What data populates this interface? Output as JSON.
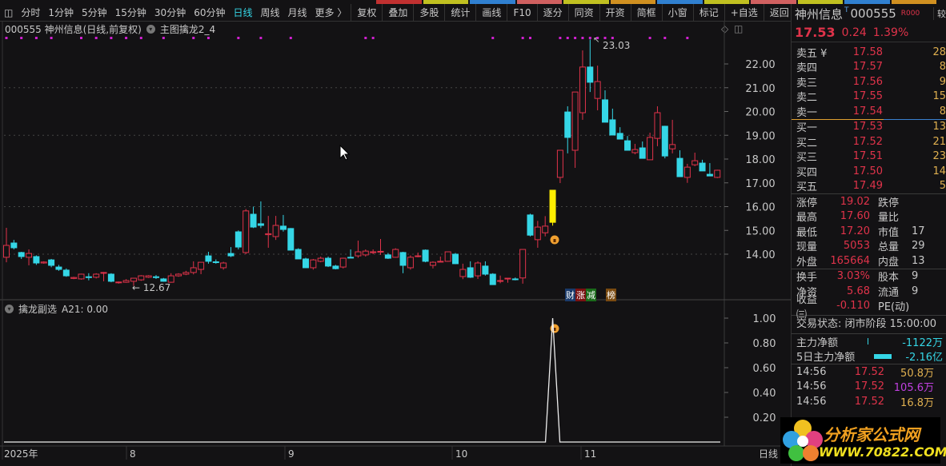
{
  "toolbar": {
    "periods": [
      "分时",
      "1分钟",
      "5分钟",
      "15分钟",
      "30分钟",
      "60分钟",
      "日线",
      "周线",
      "月线",
      "更多 〉"
    ],
    "active": "日线",
    "buttons": [
      "复权",
      "叠加",
      "多股",
      "统计",
      "画线",
      "F10",
      "逐分",
      "同资",
      "开资",
      "简框",
      "小窗",
      "标记",
      "+自选",
      "返回"
    ]
  },
  "chart_header": {
    "title": "000555 神州信息(日线,前复权)",
    "indicator": "主图擒龙2_4"
  },
  "sub_header": {
    "name": "擒龙副选",
    "value": "A21: 0.00"
  },
  "annotations": {
    "high": "23.03",
    "low": "12.67"
  },
  "event_tags": [
    {
      "text": "财",
      "bg": "#1a3a6a"
    },
    {
      "text": "涨",
      "bg": "#7a1010"
    },
    {
      "text": "减",
      "bg": "#1a6a1a"
    },
    {
      "text": "榜",
      "bg": "#7a4a10"
    }
  ],
  "time_axis": {
    "labels": [
      "2025年",
      "8",
      "9",
      "10",
      "11"
    ],
    "period": "日线"
  },
  "chart_data": {
    "type": "candlestick",
    "price_ticks": [
      "22.00",
      "21.00",
      "20.00",
      "19.00",
      "18.00",
      "17.00",
      "16.00",
      "15.00",
      "14.00"
    ],
    "price_range": [
      12.3,
      23.3
    ],
    "ohlc": [
      [
        13.87,
        15.11,
        13.66,
        14.37
      ],
      [
        14.47,
        14.6,
        14.2,
        14.27
      ],
      [
        14.07,
        14.1,
        13.8,
        13.9
      ],
      [
        13.87,
        14.2,
        13.53,
        14.03
      ],
      [
        13.9,
        13.95,
        13.55,
        13.63
      ],
      [
        13.63,
        13.7,
        13.6,
        13.67
      ],
      [
        13.76,
        13.8,
        13.45,
        13.53
      ],
      [
        13.46,
        13.55,
        13.3,
        13.36
      ],
      [
        13.33,
        13.4,
        13.05,
        13.09
      ],
      [
        12.98,
        13.05,
        12.95,
        13.02
      ],
      [
        12.96,
        13.18,
        12.93,
        13.16
      ],
      [
        13.05,
        13.2,
        12.9,
        13.02
      ],
      [
        13.03,
        13.2,
        12.98,
        13.16
      ],
      [
        13.2,
        13.25,
        12.86,
        13.23
      ],
      [
        13.16,
        13.2,
        12.82,
        12.86
      ],
      [
        12.8,
        12.85,
        12.76,
        12.83
      ],
      [
        12.82,
        12.95,
        12.8,
        12.89
      ],
      [
        12.86,
        13.0,
        12.67,
        12.99
      ],
      [
        12.92,
        13.12,
        12.88,
        13.09
      ],
      [
        13.03,
        13.12,
        13.0,
        13.09
      ],
      [
        13.05,
        13.12,
        12.96,
        13.02
      ],
      [
        12.96,
        13.0,
        12.84,
        12.86
      ],
      [
        12.82,
        13.2,
        12.8,
        13.09
      ],
      [
        13.09,
        13.2,
        13.05,
        13.16
      ],
      [
        13.16,
        13.3,
        13.12,
        13.23
      ],
      [
        13.23,
        13.7,
        13.15,
        13.43
      ],
      [
        13.36,
        13.66,
        13.16,
        13.66
      ],
      [
        13.93,
        14.1,
        13.6,
        13.7
      ],
      [
        13.68,
        13.78,
        13.6,
        13.66
      ],
      [
        13.43,
        13.68,
        13.35,
        13.63
      ],
      [
        14.03,
        14.3,
        13.88,
        13.93
      ],
      [
        14.94,
        15.0,
        14.2,
        14.3
      ],
      [
        14.07,
        15.9,
        14.0,
        15.82
      ],
      [
        15.68,
        16.0,
        15.1,
        15.14
      ],
      [
        15.28,
        16.22,
        15.1,
        15.21
      ],
      [
        14.82,
        15.61,
        14.27,
        14.86
      ],
      [
        14.74,
        15.61,
        14.6,
        15.21
      ],
      [
        15.18,
        15.65,
        14.95,
        15.04
      ],
      [
        15.08,
        15.1,
        14.17,
        14.17
      ],
      [
        14.2,
        14.25,
        13.8,
        13.8
      ],
      [
        13.8,
        13.85,
        13.43,
        13.43
      ],
      [
        13.43,
        13.8,
        13.35,
        13.76
      ],
      [
        13.7,
        13.9,
        13.66,
        13.83
      ],
      [
        13.83,
        13.9,
        13.46,
        13.5
      ],
      [
        13.5,
        13.55,
        13.36,
        13.39
      ],
      [
        13.46,
        13.85,
        13.4,
        13.83
      ],
      [
        13.87,
        14.2,
        13.85,
        13.85
      ],
      [
        13.93,
        14.57,
        13.85,
        14.1
      ],
      [
        13.97,
        14.2,
        13.9,
        14.13
      ],
      [
        14.1,
        14.2,
        14.0,
        14.1
      ],
      [
        14.1,
        14.64,
        13.97,
        14.12
      ],
      [
        13.97,
        14.05,
        13.8,
        13.83
      ],
      [
        13.87,
        14.25,
        13.85,
        14.2
      ],
      [
        14.07,
        14.1,
        13.2,
        13.53
      ],
      [
        13.43,
        13.95,
        13.35,
        13.87
      ],
      [
        13.9,
        14.07,
        13.87,
        13.93
      ],
      [
        14.17,
        14.2,
        13.66,
        13.7
      ],
      [
        13.53,
        13.7,
        13.4,
        13.66
      ],
      [
        13.67,
        13.9,
        13.66,
        13.7
      ],
      [
        13.7,
        14.1,
        13.68,
        14.1
      ],
      [
        14.0,
        14.05,
        13.58,
        13.6
      ],
      [
        13.06,
        13.6,
        12.95,
        13.36
      ],
      [
        13.43,
        13.7,
        13.0,
        13.03
      ],
      [
        13.09,
        13.7,
        12.96,
        13.63
      ],
      [
        13.5,
        13.7,
        13.1,
        13.16
      ],
      [
        13.16,
        13.2,
        12.72,
        12.72
      ],
      [
        12.86,
        13.1,
        12.78,
        12.89
      ],
      [
        12.96,
        13.0,
        12.8,
        12.99
      ],
      [
        12.96,
        13.02,
        12.9,
        12.94
      ],
      [
        13.0,
        14.2,
        12.76,
        14.2
      ],
      [
        15.65,
        15.7,
        14.75,
        14.8
      ],
      [
        14.61,
        15.4,
        14.27,
        15.14
      ],
      [
        14.9,
        15.6,
        14.75,
        15.18
      ],
      [
        15.34,
        16.69,
        15.2,
        16.69
      ],
      [
        17.23,
        18.37,
        16.99,
        18.37
      ],
      [
        19.98,
        20.22,
        18.24,
        18.91
      ],
      [
        18.37,
        20.82,
        17.63,
        20.82
      ],
      [
        19.95,
        22.57,
        19.65,
        21.87
      ],
      [
        21.87,
        23.03,
        20.82,
        21.23
      ],
      [
        20.55,
        21.93,
        20.05,
        21.26
      ],
      [
        20.49,
        20.89,
        19.55,
        19.55
      ],
      [
        19.65,
        20.12,
        19.01,
        19.01
      ],
      [
        19.08,
        19.34,
        18.84,
        18.84
      ],
      [
        18.77,
        18.97,
        18.37,
        18.37
      ],
      [
        18.27,
        18.64,
        18.2,
        18.4
      ],
      [
        18.47,
        18.74,
        18.03,
        18.03
      ],
      [
        17.97,
        19.11,
        17.97,
        18.91
      ],
      [
        18.87,
        20.22,
        18.54,
        19.95
      ],
      [
        19.38,
        19.4,
        18.03,
        18.13
      ],
      [
        18.43,
        19.65,
        18.24,
        18.61
      ],
      [
        18.03,
        18.37,
        17.26,
        17.26
      ],
      [
        17.23,
        17.8,
        17.0,
        17.66
      ],
      [
        17.76,
        18.27,
        17.7,
        17.93
      ],
      [
        17.83,
        17.97,
        17.5,
        17.5
      ],
      [
        17.36,
        17.83,
        17.3,
        17.29
      ],
      [
        17.23,
        17.55,
        17.2,
        17.53
      ]
    ],
    "highlight_index": 73,
    "signal_dots": [
      0,
      2,
      4,
      6,
      10,
      12,
      14,
      16,
      18,
      21,
      25,
      27,
      31,
      34,
      38,
      48,
      49,
      65,
      69,
      70,
      74,
      75,
      76,
      77,
      78,
      79,
      80,
      81,
      86,
      88,
      91
    ],
    "sub": {
      "ticks": [
        "1.00",
        "0.80",
        "0.60",
        "0.40",
        "0.20"
      ],
      "range": [
        0,
        1.05
      ],
      "spike_index": 73,
      "spike_value": 1.0,
      "baseline": 0
    }
  },
  "colors": {
    "up": "#e0334a",
    "down": "#35d6e6",
    "limit": "#ffee00",
    "dot": "#d020d0"
  },
  "quote": {
    "name": "神州信息",
    "code": "000555",
    "tag": "R000",
    "price": "17.53",
    "change": "0.24",
    "pct": "1.39%",
    "side_label": "较"
  },
  "book": {
    "asks": [
      {
        "l": "卖五 ¥",
        "p": "17.58",
        "v": "28"
      },
      {
        "l": "卖四",
        "p": "17.57",
        "v": "8"
      },
      {
        "l": "卖三",
        "p": "17.56",
        "v": "9"
      },
      {
        "l": "卖二",
        "p": "17.55",
        "v": "15"
      },
      {
        "l": "卖一",
        "p": "17.54",
        "v": "8"
      }
    ],
    "bids": [
      {
        "l": "买一",
        "p": "17.53",
        "v": "13"
      },
      {
        "l": "买二",
        "p": "17.52",
        "v": "21"
      },
      {
        "l": "买三",
        "p": "17.51",
        "v": "23"
      },
      {
        "l": "买四",
        "p": "17.50",
        "v": "14"
      },
      {
        "l": "买五",
        "p": "17.49",
        "v": "5"
      }
    ]
  },
  "stats": [
    {
      "a": "涨停",
      "b": "19.02",
      "d": "跌停",
      "e": ""
    },
    {
      "a": "最高",
      "b": "17.60",
      "d": "量比",
      "e": ""
    },
    {
      "a": "最低",
      "b": "17.20",
      "d": "市值",
      "e": "17"
    },
    {
      "a": "现量",
      "b": "5053",
      "d": "总量",
      "e": "29"
    },
    {
      "a": "外盘",
      "b": "165664",
      "d": "内盘",
      "e": "13"
    }
  ],
  "fund": [
    {
      "a": "换手",
      "b": "3.03%",
      "d": "股本",
      "e": "9"
    },
    {
      "a": "净资",
      "b": "5.68",
      "d": "流通",
      "e": "9"
    },
    {
      "a": "收益㈢",
      "b": "-0.110",
      "d": "PE(动)",
      "e": ""
    }
  ],
  "trade_status": "交易状态: 闭市阶段 15:00:00",
  "flow": [
    {
      "l": "主力净额",
      "v": "-1122万"
    },
    {
      "l": "5日主力净额",
      "v": "-2.16亿"
    }
  ],
  "ticks": [
    {
      "t": "14:56",
      "p": "17.52",
      "v": "50.8万"
    },
    {
      "t": "14:56",
      "p": "17.52",
      "v": "105.6万"
    },
    {
      "t": "14:56",
      "p": "17.52",
      "v": "16.8万"
    }
  ],
  "logo": {
    "text": "分析家公式网",
    "url": "WWW.70822.COM"
  }
}
